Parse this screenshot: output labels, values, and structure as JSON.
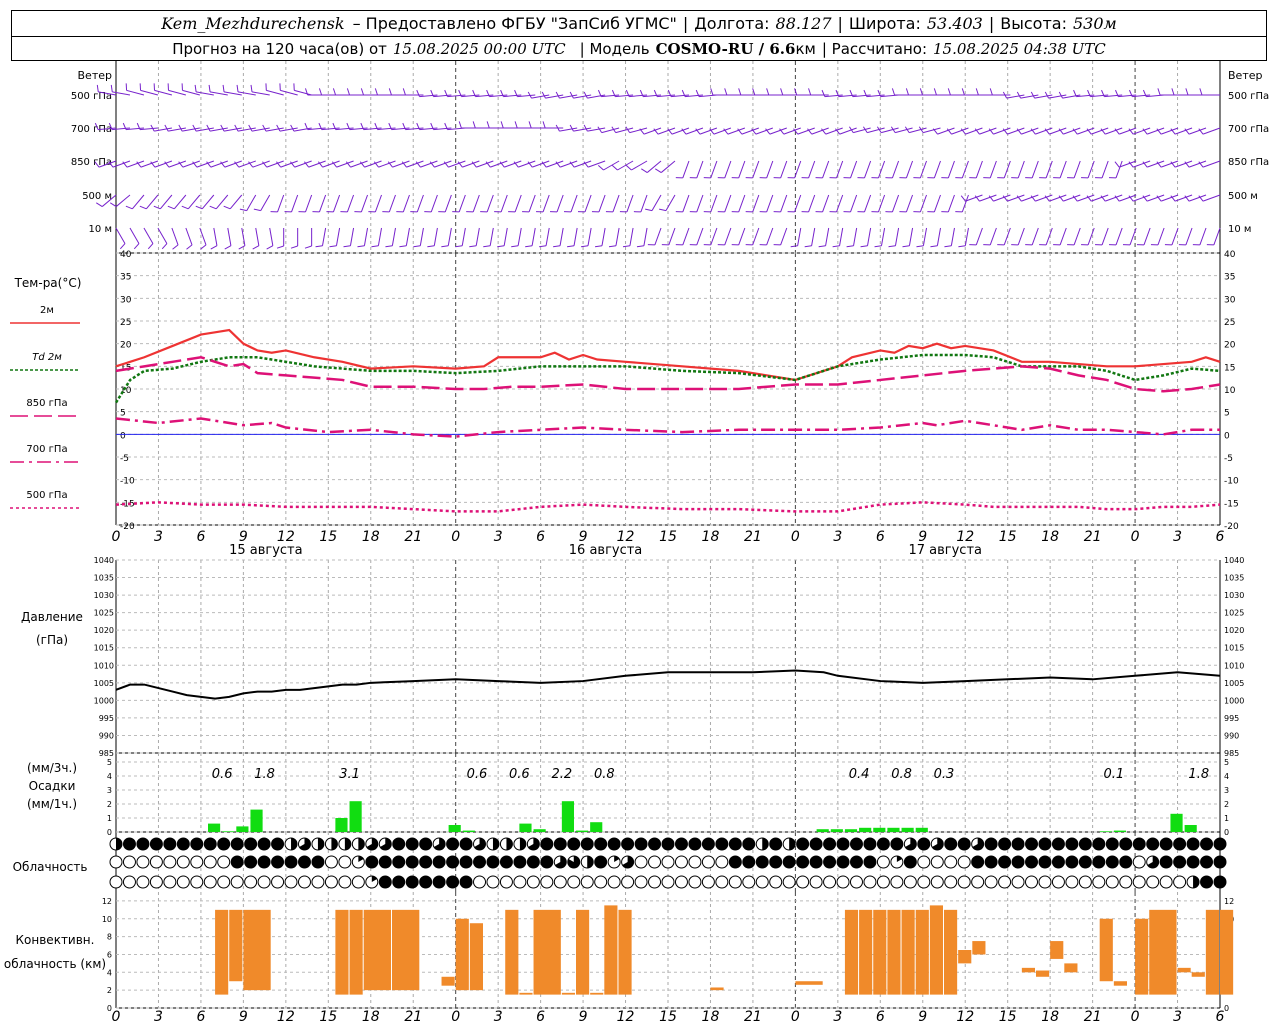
{
  "header": {
    "station": "Kem_Mezhdurechensk",
    "provider": "– Предоставлено ФГБУ \"ЗапСиб УГМС\"",
    "lon_label": "Долгота:",
    "lon": "88.127",
    "lat_label": "Широта:",
    "lat": "53.403",
    "alt_label": "Высота:",
    "alt": "530м",
    "forecast_label": "Прогноз на 120 часа(ов) от",
    "init_time": "15.08.2025 00:00 UTC",
    "model_label": "| Модель",
    "model": "COSMO-RU / 6.6",
    "model_unit": "км",
    "calc_label": "| Рассчитано:",
    "calc_time": "15.08.2025 04:38 UTC"
  },
  "labels": {
    "wind": "Ветер",
    "wind_levels": [
      "500 гПа",
      "700 гПа",
      "850 гПа",
      "500 м",
      "10 м"
    ],
    "temp": "Тем-ра(°C)",
    "legend": [
      "2м",
      "Td 2м",
      "850 гПа",
      "700 гПа",
      "500 гПа"
    ],
    "pressure": "Давление",
    "pressure_unit": "(гПа)",
    "precip_3h": "(мм/3ч.)",
    "precip": "Осадки",
    "precip_1h": "(мм/1ч.)",
    "cloud": "Облачность",
    "conv": "Конвективн. облачность (км)"
  },
  "dates": [
    "15 августа",
    "16 августа",
    "17 августа"
  ],
  "hour_labels": [
    "0",
    "3",
    "6",
    "9",
    "12",
    "15",
    "18",
    "21",
    "0",
    "3",
    "6",
    "9",
    "12",
    "15",
    "18",
    "21",
    "0",
    "3",
    "6",
    "9",
    "12",
    "15",
    "18",
    "21",
    "0",
    "3",
    "6"
  ],
  "colors": {
    "t2m": "#ee3333",
    "td2m": "#117711",
    "t850": "#dd1177",
    "t700": "#dd1177",
    "t500": "#dd1177",
    "pressure": "#000000",
    "precip": "#11dd11",
    "conv": "#f08a2a",
    "wind": "#7722cc",
    "zero": "#2222ee"
  },
  "chart_data": [
    {
      "type": "line",
      "title": "Тем-ра(°C)",
      "x_unit": "hours since 15.08.2025 00:00 UTC",
      "ylim": [
        -20,
        40
      ],
      "grid": true,
      "series": [
        {
          "name": "2м",
          "x": [
            0,
            2,
            4,
            6,
            7,
            8,
            9,
            10,
            11,
            12,
            14,
            16,
            18,
            21,
            24,
            26,
            27,
            30,
            31,
            32,
            33,
            34,
            36,
            40,
            44,
            48,
            51,
            52,
            54,
            55,
            56,
            57,
            58,
            59,
            60,
            62,
            64,
            66,
            68,
            70,
            72,
            74,
            76,
            77,
            78
          ],
          "y": [
            15,
            17,
            19.5,
            22,
            22.5,
            23,
            20,
            18.5,
            18,
            18.5,
            17,
            16,
            14.5,
            15,
            14.5,
            15,
            17,
            17,
            18,
            16.5,
            17.5,
            16.5,
            16,
            15,
            14,
            12,
            15,
            17,
            18.5,
            18,
            19.5,
            19,
            20,
            19,
            19.5,
            18.5,
            16,
            16,
            15.5,
            15,
            15,
            15.5,
            16,
            17,
            16
          ]
        },
        {
          "name": "Td 2м",
          "x": [
            0,
            1,
            2,
            4,
            6,
            8,
            10,
            12,
            14,
            16,
            18,
            21,
            24,
            27,
            30,
            33,
            36,
            40,
            44,
            48,
            51,
            54,
            57,
            60,
            62,
            64,
            66,
            68,
            70,
            72,
            74,
            76,
            78
          ],
          "y": [
            7,
            12,
            14,
            14.5,
            16,
            17,
            17,
            16,
            15,
            14.5,
            14,
            14,
            13.5,
            14,
            15,
            15,
            15,
            14,
            13.5,
            12,
            15,
            16.5,
            17.5,
            17.5,
            17,
            15,
            15,
            15,
            14,
            12,
            13,
            14.5,
            14
          ]
        },
        {
          "name": "850 гПа",
          "x": [
            0,
            2,
            4,
            6,
            7,
            8,
            9,
            10,
            12,
            14,
            16,
            18,
            21,
            24,
            26,
            28,
            30,
            33,
            36,
            40,
            44,
            48,
            51,
            54,
            57,
            60,
            62,
            64,
            66,
            68,
            70,
            72,
            74,
            76,
            78
          ],
          "y": [
            14,
            15,
            16,
            17,
            16,
            15,
            15.5,
            13.5,
            13,
            12.5,
            12,
            10.5,
            10.5,
            10,
            10,
            10.5,
            10.5,
            11,
            10,
            10,
            10,
            11,
            11,
            12,
            13,
            14,
            14.5,
            15,
            14.5,
            13,
            12,
            10,
            9.5,
            10,
            11
          ]
        },
        {
          "name": "700 гПа",
          "x": [
            0,
            3,
            6,
            9,
            11,
            12,
            15,
            18,
            21,
            24,
            27,
            30,
            33,
            36,
            40,
            44,
            48,
            51,
            54,
            57,
            58,
            60,
            62,
            64,
            66,
            68,
            70,
            72,
            74,
            76,
            78
          ],
          "y": [
            3.5,
            2.5,
            3.5,
            2,
            2.5,
            1.5,
            0.5,
            1,
            0,
            -0.5,
            0.5,
            1,
            1.5,
            1,
            0.5,
            1,
            1,
            1,
            1.5,
            2.5,
            2,
            3,
            2,
            1,
            2,
            1,
            1,
            0.5,
            0,
            1,
            1
          ]
        },
        {
          "name": "500 гПа",
          "x": [
            0,
            3,
            6,
            9,
            12,
            15,
            18,
            21,
            24,
            27,
            30,
            33,
            36,
            40,
            44,
            48,
            51,
            54,
            57,
            60,
            62,
            64,
            66,
            68,
            70,
            72,
            74,
            76,
            78
          ],
          "y": [
            -15.5,
            -15,
            -15.5,
            -15.5,
            -16,
            -16,
            -16,
            -16.5,
            -17,
            -17,
            -16,
            -15.5,
            -16,
            -16.5,
            -16.5,
            -17,
            -17,
            -15.5,
            -15,
            -15.5,
            -16,
            -16,
            -16,
            -16,
            -16.5,
            -16.5,
            -16,
            -16,
            -15.5
          ]
        }
      ]
    },
    {
      "type": "line",
      "title": "Давление (гПа)",
      "ylim": [
        985,
        1040
      ],
      "grid": true,
      "series": [
        {
          "name": "",
          "x": [
            0,
            1,
            2,
            3,
            4,
            5,
            6,
            7,
            8,
            9,
            10,
            11,
            12,
            13,
            14,
            15,
            16,
            17,
            18,
            21,
            24,
            27,
            30,
            33,
            36,
            39,
            42,
            45,
            48,
            50,
            51,
            54,
            57,
            60,
            63,
            66,
            69,
            72,
            75,
            78
          ],
          "y": [
            1003,
            1004.5,
            1004.5,
            1003.5,
            1002.5,
            1001.5,
            1001,
            1000.5,
            1001,
            1002,
            1002.5,
            1002.5,
            1003,
            1003,
            1003.5,
            1004,
            1004.5,
            1004.5,
            1005,
            1005.5,
            1006,
            1005.5,
            1005,
            1005.5,
            1007,
            1008,
            1008,
            1008,
            1008.5,
            1008,
            1007,
            1005.5,
            1005,
            1005.5,
            1006,
            1006.5,
            1006,
            1007,
            1008,
            1007
          ]
        }
      ]
    },
    {
      "type": "bar",
      "title": "Осадки",
      "ylim": [
        0,
        5
      ],
      "x_hourly": [
        7,
        8,
        9,
        10,
        16,
        17,
        24,
        25,
        29,
        30,
        32,
        33,
        34,
        50,
        51,
        52,
        53,
        54,
        55,
        56,
        57,
        70,
        71,
        75,
        76
      ],
      "hourly_mm": [
        0.6,
        0.05,
        0.4,
        1.6,
        1.0,
        2.2,
        0.5,
        0.1,
        0.6,
        0.2,
        2.2,
        0.1,
        0.7,
        0.2,
        0.2,
        0.2,
        0.3,
        0.3,
        0.3,
        0.3,
        0.3,
        0.05,
        0.1,
        1.3,
        0.5
      ],
      "accum_3h": [
        {
          "x": 7.5,
          "label": "0.6"
        },
        {
          "x": 10.5,
          "label": "1.8"
        },
        {
          "x": 16.5,
          "label": "3.1"
        },
        {
          "x": 25.5,
          "label": "0.6"
        },
        {
          "x": 28.5,
          "label": "0.6"
        },
        {
          "x": 31.5,
          "label": "2.2"
        },
        {
          "x": 34.5,
          "label": "0.8"
        },
        {
          "x": 52.5,
          "label": "0.4"
        },
        {
          "x": 55.5,
          "label": "0.8"
        },
        {
          "x": 58.5,
          "label": "0.3"
        },
        {
          "x": 70.5,
          "label": "0.1"
        },
        {
          "x": 76.5,
          "label": "1.8"
        }
      ]
    },
    {
      "type": "table",
      "title": "Облачность",
      "rows_cover": [
        "36666666666663433334466646643334666666666666666636366666666464664666666666666666666",
        "00000000066666660016666666666666645361400000006666666666601600006666666666660466666",
        "00000000000000000001666666600000000000000000000000000000000000000000000000000000366"
      ]
    },
    {
      "type": "bar",
      "title": "Конвективн. облачность (км)",
      "ylim": [
        0,
        13
      ],
      "segments": [
        {
          "x": 7.5,
          "w": 1,
          "base": 1.5,
          "top": 11
        },
        {
          "x": 8.5,
          "w": 1,
          "base": 3,
          "top": 11
        },
        {
          "x": 9.5,
          "w": 2,
          "base": 2,
          "top": 11
        },
        {
          "x": 16,
          "w": 1,
          "base": 1.5,
          "top": 11
        },
        {
          "x": 17,
          "w": 1,
          "base": 1.5,
          "top": 11
        },
        {
          "x": 18,
          "w": 2,
          "base": 2,
          "top": 11
        },
        {
          "x": 20,
          "w": 2,
          "base": 2,
          "top": 11
        },
        {
          "x": 23.5,
          "w": 1,
          "base": 2.5,
          "top": 3.5
        },
        {
          "x": 24.5,
          "w": 1,
          "base": 2,
          "top": 10
        },
        {
          "x": 25.5,
          "w": 1,
          "base": 2,
          "top": 9.5
        },
        {
          "x": 28,
          "w": 1,
          "base": 1.5,
          "top": 11
        },
        {
          "x": 29,
          "w": 1,
          "base": 1.5,
          "top": 1.7
        },
        {
          "x": 30,
          "w": 2,
          "base": 1.5,
          "top": 11
        },
        {
          "x": 32,
          "w": 1,
          "base": 1.5,
          "top": 1.7
        },
        {
          "x": 33,
          "w": 1,
          "base": 1.5,
          "top": 11
        },
        {
          "x": 34,
          "w": 1,
          "base": 1.5,
          "top": 1.7
        },
        {
          "x": 35,
          "w": 1,
          "base": 1.5,
          "top": 11.5
        },
        {
          "x": 36,
          "w": 1,
          "base": 1.5,
          "top": 11
        },
        {
          "x": 42.5,
          "w": 1,
          "base": 2,
          "top": 2.3
        },
        {
          "x": 48.5,
          "w": 2,
          "base": 2.6,
          "top": 3
        },
        {
          "x": 52,
          "w": 1,
          "base": 1.5,
          "top": 11
        },
        {
          "x": 53,
          "w": 1,
          "base": 1.5,
          "top": 11
        },
        {
          "x": 54,
          "w": 1,
          "base": 1.5,
          "top": 11
        },
        {
          "x": 55,
          "w": 1,
          "base": 1.5,
          "top": 11
        },
        {
          "x": 56,
          "w": 1,
          "base": 1.5,
          "top": 11
        },
        {
          "x": 57,
          "w": 1,
          "base": 1.5,
          "top": 11
        },
        {
          "x": 58,
          "w": 1,
          "base": 1.5,
          "top": 11.5
        },
        {
          "x": 59,
          "w": 1,
          "base": 1.5,
          "top": 11
        },
        {
          "x": 60,
          "w": 1,
          "base": 5,
          "top": 6.5
        },
        {
          "x": 61,
          "w": 1,
          "base": 6,
          "top": 7.5
        },
        {
          "x": 64.5,
          "w": 1,
          "base": 4,
          "top": 4.5
        },
        {
          "x": 65.5,
          "w": 1,
          "base": 3.5,
          "top": 4.2
        },
        {
          "x": 66.5,
          "w": 1,
          "base": 5.5,
          "top": 7.5
        },
        {
          "x": 67.5,
          "w": 1,
          "base": 4,
          "top": 5
        },
        {
          "x": 70,
          "w": 1,
          "base": 3,
          "top": 10
        },
        {
          "x": 71,
          "w": 1,
          "base": 2.5,
          "top": 3
        },
        {
          "x": 72.5,
          "w": 1,
          "base": 1.5,
          "top": 10
        },
        {
          "x": 73.5,
          "w": 2,
          "base": 1.5,
          "top": 11
        },
        {
          "x": 75.5,
          "w": 1,
          "base": 4,
          "top": 4.5
        },
        {
          "x": 76.5,
          "w": 1,
          "base": 3.5,
          "top": 4
        },
        {
          "x": 77.5,
          "w": 1,
          "base": 1.5,
          "top": 11
        },
        {
          "x": 78.5,
          "w": 1,
          "base": 1.5,
          "top": 11
        }
      ]
    },
    {
      "type": "scatter",
      "title": "Ветер",
      "levels": [
        "500 гПа",
        "700 гПа",
        "850 гПа",
        "500 м",
        "10 м"
      ],
      "dir_deg": [
        [
          280,
          285,
          285,
          280,
          280,
          285,
          270,
          270,
          270,
          265,
          265,
          265,
          260,
          260,
          265,
          265,
          265,
          270,
          270,
          270,
          265,
          265,
          270,
          270,
          270,
          260,
          260,
          265,
          265,
          270,
          270
        ],
        [
          265,
          265,
          260,
          260,
          260,
          260,
          265,
          265,
          265,
          265,
          270,
          270,
          270,
          260,
          255,
          250,
          250,
          250,
          250,
          250,
          250,
          255,
          255,
          250,
          250,
          250,
          250,
          250,
          250,
          250,
          250
        ],
        [
          250,
          250,
          250,
          250,
          250,
          250,
          250,
          250,
          250,
          250,
          250,
          250,
          250,
          250,
          240,
          230,
          200,
          200,
          200,
          200,
          200,
          200,
          200,
          200,
          200,
          200,
          200,
          200,
          250,
          250,
          250
        ],
        [
          230,
          220,
          220,
          220,
          210,
          200,
          200,
          200,
          200,
          200,
          200,
          200,
          200,
          200,
          200,
          210,
          200,
          200,
          200,
          200,
          200,
          200,
          200,
          200,
          250,
          250,
          250,
          250,
          250,
          250,
          250
        ],
        [
          150,
          150,
          160,
          170,
          170,
          180,
          190,
          190,
          190,
          190,
          190,
          190,
          190,
          190,
          190,
          200,
          200,
          200,
          200,
          190,
          190,
          190,
          190,
          190,
          200,
          200,
          200,
          200,
          200,
          200,
          200
        ]
      ]
    }
  ]
}
